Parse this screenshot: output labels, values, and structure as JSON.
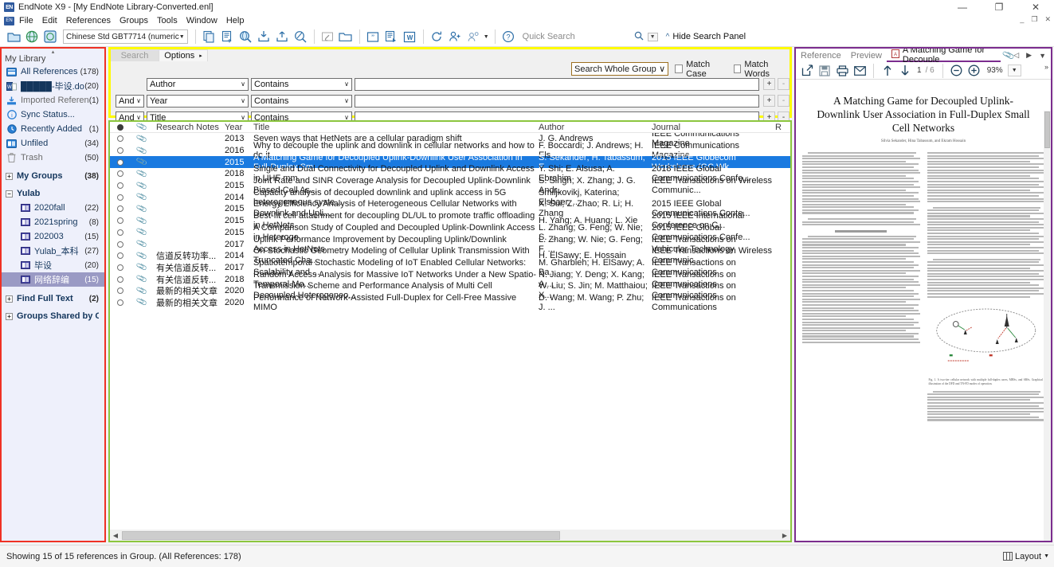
{
  "window": {
    "app_icon": "endnote-logo-icon",
    "title": "EndNote X9 - [My EndNote Library-Converted.enl]",
    "minimize": "—",
    "maximize": "❐",
    "close": "✕",
    "mdi_minimize": "_",
    "mdi_restore": "❐",
    "mdi_close": "✕"
  },
  "menu": {
    "items": [
      "File",
      "Edit",
      "References",
      "Groups",
      "Tools",
      "Window",
      "Help"
    ]
  },
  "toolbar": {
    "style": "Chinese Std GBT7714 (numeric",
    "style_arrow": "▼",
    "quick_search_placeholder": "Quick Search",
    "quick_search_value": "",
    "search_dropdown_arrow": "▼",
    "hide_search_panel": "Hide Search Panel",
    "icons": [
      "open-library-icon",
      "online-search-icon",
      "online-search-mode-icon",
      "new-reference-icon",
      "edit-reference-icon",
      "search-web-icon",
      "import-icon",
      "export-icon",
      "find-full-text-icon",
      "attach-file-icon",
      "open-folder-icon",
      "quote-icon",
      "insert-citation-icon",
      "word-cwyw-icon",
      "sync-icon",
      "share-group-icon",
      "share-library-icon",
      "help-icon"
    ]
  },
  "sidebar": {
    "header": "My Library",
    "items": [
      {
        "label": "All References",
        "count": "(178)",
        "icon": "all-references-icon",
        "type": "root",
        "color": "#2a7fd4"
      },
      {
        "label": "█████-毕设.docx",
        "count": "(20)",
        "icon": "word-doc-icon",
        "type": "root",
        "color": "#2f5a9e"
      },
      {
        "label": "Imported References",
        "count": "(1)",
        "icon": "imported-references-icon",
        "type": "root",
        "color": "#2a7fd4"
      },
      {
        "label": "Sync Status...",
        "count": "",
        "icon": "sync-status-icon",
        "type": "root",
        "color": "#2a7fd4"
      },
      {
        "label": "Recently Added",
        "count": "(1)",
        "icon": "recently-added-icon",
        "type": "root",
        "color": "#2a7fd4"
      },
      {
        "label": "Unfiled",
        "count": "(34)",
        "icon": "unfiled-icon",
        "type": "root",
        "color": "#2a7fd4"
      },
      {
        "label": "Trash",
        "count": "(50)",
        "icon": "trash-icon",
        "type": "root",
        "color": "#8d8d8d"
      }
    ],
    "groups": [
      {
        "label": "My Groups",
        "count": "(38)",
        "expander": "+",
        "type": "header"
      },
      {
        "label": "Yulab",
        "count": "",
        "expander": "−",
        "type": "header"
      }
    ],
    "yulab_children": [
      {
        "label": "2020fall",
        "count": "(22)",
        "selected": false
      },
      {
        "label": "2021spring",
        "count": "(8)",
        "selected": false
      },
      {
        "label": "202003",
        "count": "(15)",
        "selected": false
      },
      {
        "label": "Yulab_本科",
        "count": "(27)",
        "selected": false
      },
      {
        "label": "毕设",
        "count": "(20)",
        "selected": false
      },
      {
        "label": "网络辞编",
        "count": "(15)",
        "selected": true
      }
    ],
    "footer_groups": [
      {
        "label": "Find Full Text",
        "count": "(2)",
        "expander": "+"
      },
      {
        "label": "Groups Shared by Ot...",
        "count": "",
        "expander": "+"
      }
    ]
  },
  "search_panel": {
    "tab_search": "Search",
    "tab_options": "Options",
    "options_arrow": "▸",
    "scope": "Search Whole Group",
    "scope_arrow": "∨",
    "match_case": "Match Case",
    "match_words": "Match Words",
    "rows": [
      {
        "bool": "",
        "field": "Author",
        "op": "Contains",
        "value": "",
        "plus": "+",
        "minus": "-"
      },
      {
        "bool": "And",
        "field": "Year",
        "op": "Contains",
        "value": "",
        "plus": "+",
        "minus": "-"
      },
      {
        "bool": "And",
        "field": "Title",
        "op": "Contains",
        "value": "",
        "plus": "+",
        "minus": "-"
      }
    ]
  },
  "reference_list": {
    "columns": [
      "",
      "",
      "Research Notes",
      "Year",
      "Title",
      "Author",
      "Journal",
      "R"
    ],
    "rows": [
      {
        "notes": "",
        "year": "2013",
        "title": "Seven ways that HetNets are a cellular paradigm shift",
        "author": "J. G. Andrews",
        "journal": "IEEE Communications Magazine",
        "selected": false
      },
      {
        "notes": "",
        "year": "2016",
        "title": "Why to decouple the uplink and downlink in cellular networks and how to do it",
        "author": "F. Boccardi; J. Andrews; H. Els...",
        "journal": "IEEE Communications Magazine",
        "selected": false
      },
      {
        "notes": "",
        "year": "2015",
        "title": "A Matching Game for Decoupled Uplink-Downlink User Association in Full-Duplex Sm...",
        "author": "S. Sekander; H. Tabassum; E. ...",
        "journal": "2015 IEEE Globecom Workshops (GC Wk...",
        "selected": true
      },
      {
        "notes": "",
        "year": "2018",
        "title": "Single and Dual Connectivity for Decoupled Uplink and Downlink Access in UHF mm...",
        "author": "Y. Shi; E. Alsusa; A. Ebrahim",
        "journal": "2018 IEEE Global Communications Confe...",
        "selected": false
      },
      {
        "notes": "",
        "year": "2015",
        "title": "Joint Rate and SINR Coverage Analysis for Decoupled Uplink-Downlink Biased Cell As...",
        "author": "S. Singh; X. Zhang; J. G. Andr...",
        "journal": "IEEE Transactions on Wireless Communic...",
        "selected": false
      },
      {
        "notes": "",
        "year": "2014",
        "title": "Capacity analysis of decoupled downlink and uplink access in 5G heterogeneous syste...",
        "author": "Smiljkovikj, Katerina; Elshaer, ...",
        "journal": "",
        "selected": false
      },
      {
        "notes": "",
        "year": "2015",
        "title": "Energy Efficiency Analysis of Heterogeneous Cellular Networks with Downlink and Upli...",
        "author": "X. Sui; Z. Zhao; R. Li; H. Zhang",
        "journal": "2015 IEEE Global Communications Conte...",
        "selected": false
      },
      {
        "notes": "",
        "year": "2015",
        "title": "Best-fit cell attachment for decoupling DL/UL to promote traffic offloading in HetNets",
        "author": "H. Yang; A. Huang; L. Xie",
        "journal": "2015 IEEE International Conference on C...",
        "selected": false
      },
      {
        "notes": "",
        "year": "2015",
        "title": "A Comparison Study of Coupled and Decoupled Uplink-Downlink Access in Heteroge...",
        "author": "L. Zhang; G. Feng; W. Nie; S. ...",
        "journal": "2015 IEEE Global Communications Confe...",
        "selected": false
      },
      {
        "notes": "",
        "year": "2017",
        "title": "Uplink Performance Improvement by Decoupling Uplink/Downlink Access in HetNets",
        "author": "L. Zhang; W. Nie; G. Feng; F. ...",
        "journal": "IEEE Transactions on Vehicular Technology",
        "selected": false
      },
      {
        "notes": "信道反转功率...",
        "year": "2014",
        "title": "On Stochastic Geometry Modeling of Cellular Uplink Transmission With Truncated Cha...",
        "author": "H. ElSawy; E. Hossain",
        "journal": "IEEE Transactions on Wireless Communic...",
        "selected": false
      },
      {
        "notes": "有关信道反转...",
        "year": "2017",
        "title": "Spatiotemporal Stochastic Modeling of IoT Enabled Cellular Networks: Scalability and ...",
        "author": "M. Gharbieh; H. ElSawy; A. Ba...",
        "journal": "IEEE Transactions on Communications",
        "selected": false
      },
      {
        "notes": "有关信道反转...",
        "year": "2018",
        "title": "Random Access Analysis for Massive IoT Networks Under a New Spatio-Temporal Mo...",
        "author": "N. Jiang; Y. Deng; X. Kang; A....",
        "journal": "IEEE Transactions on Communications",
        "selected": false
      },
      {
        "notes": "最新的相关文章",
        "year": "2020",
        "title": "Transmission Scheme and Performance Analysis of Multi Cell Decoupled Heterogeneo...",
        "author": "W. Liu; S. Jin; M. Matthaiou; X...",
        "journal": "IEEE Transactions on Communications",
        "selected": false
      },
      {
        "notes": "最新的相关文章",
        "year": "2020",
        "title": "Performance of Network-Assisted Full-Duplex for Cell-Free Massive MIMO",
        "author": "D. Wang; M. Wang; P. Zhu; J. ...",
        "journal": "IEEE Transactions on Communications",
        "selected": false
      }
    ]
  },
  "pdf_panel": {
    "tabs": [
      {
        "label": "Reference",
        "active": false
      },
      {
        "label": "Preview",
        "active": false
      },
      {
        "label": "A Matching Game for Decouple",
        "active": true,
        "icon": "pdf-file-icon"
      }
    ],
    "attach_icon": "paperclip-icon",
    "prev_arrow": "◁",
    "next_arrow": "▶",
    "menu_arrow": "▼",
    "toolbar": {
      "open_external": "open-in-new-window-icon",
      "save": "save-icon",
      "print": "print-icon",
      "email": "email-icon",
      "page_up": "page-up-icon",
      "page_down": "page-down-icon",
      "page_current": "1",
      "page_total": "/ 6",
      "zoom_out": "zoom-out-icon",
      "zoom_in": "zoom-in-icon",
      "zoom_level": "93%",
      "zoom_arrow": "▼",
      "overflow": "»"
    },
    "document": {
      "title": "A Matching Game for Decoupled Uplink-Downlink User Association in Full-Duplex Small Cell Networks",
      "authors": "Silvia Sekander, Hina Tabassum, and Ekram Hossain",
      "figure_caption": "Fig. 1. A two-tier cellular network with multiple full-duplex users, MBSs, and SBSs. Graphical illustration of the DFD and TN-FD modes of operation."
    }
  },
  "status_bar": {
    "text": "Showing 15 of 15 references in Group. (All References: 178)",
    "layout_label": "Layout",
    "layout_arrow": "▼",
    "layout_icon": "layout-icon"
  }
}
